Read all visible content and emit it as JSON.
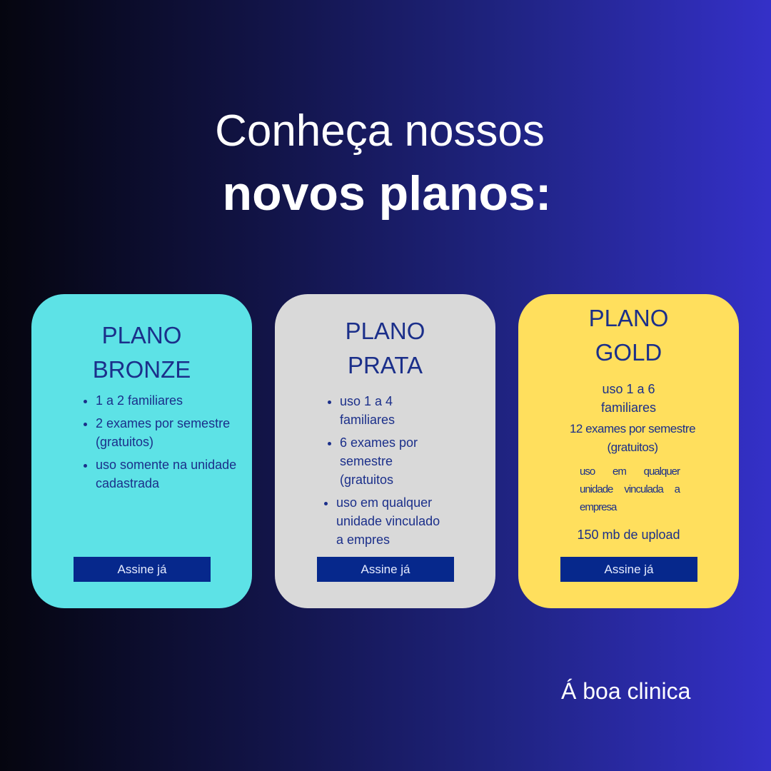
{
  "headline": {
    "line1": "Conheça nossos",
    "line2": "novos planos:"
  },
  "plans": [
    {
      "title_line1": "PLANO",
      "title_line2": "BRONZE",
      "features": [
        "1 a 2 familiares",
        "2 exames por semestre (gratuitos)",
        "uso somente na unidade cadastrada"
      ],
      "button_label": "Assine já",
      "color": "#5de2e6"
    },
    {
      "title_line1": "PLANO",
      "title_line2": "PRATA",
      "features": [
        "uso 1 a 4 familiares",
        "6 exames por semestre (gratuitos",
        "uso em qualquer unidade vinculado a empres"
      ],
      "button_label": "Assine já",
      "color": "#d9d9d9"
    },
    {
      "title_line1": "PLANO",
      "title_line2": "GOLD",
      "features": [
        "uso 1 a 6",
        "familiares",
        "12 exames por semestre (gratuitos)",
        "uso em qualquer unidade vinculada a empresa",
        "150 mb de upload"
      ],
      "button_label": "Assine já",
      "color": "#ffdf5d"
    }
  ],
  "brand": "Á boa clinica",
  "colors": {
    "text_dark_blue": "#1b2f8a",
    "button_bg": "#06288c",
    "background_start": "#05050f",
    "background_end": "#3430c8"
  }
}
